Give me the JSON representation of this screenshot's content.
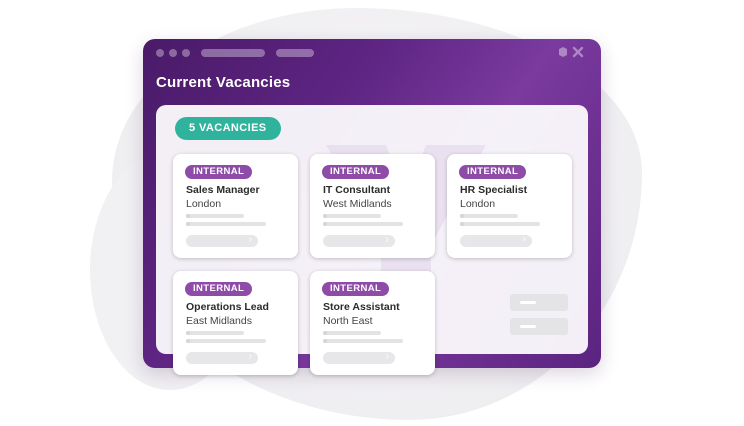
{
  "window": {
    "title": "Current Vacancies"
  },
  "summary": {
    "vacancies_label": "5 VACANCIES"
  },
  "jobs": [
    {
      "badge": "INTERNAL",
      "title": "Sales Manager",
      "location": "London"
    },
    {
      "badge": "INTERNAL",
      "title": "IT Consultant",
      "location": "West Midlands"
    },
    {
      "badge": "INTERNAL",
      "title": "HR Specialist",
      "location": "London"
    },
    {
      "badge": "INTERNAL",
      "title": "Operations Lead",
      "location": "East Midlands"
    },
    {
      "badge": "INTERNAL",
      "title": "Store Assistant",
      "location": "North East"
    }
  ],
  "icons": {
    "card_button": "chevron-right-icon",
    "window_controls": [
      "minimize-icon",
      "close-icon"
    ]
  },
  "colors": {
    "window_gradient_start": "#4a1a68",
    "window_gradient_end": "#7a3a9e",
    "accent_teal": "#2fb39c",
    "badge_purple": "#8e4ba7"
  }
}
